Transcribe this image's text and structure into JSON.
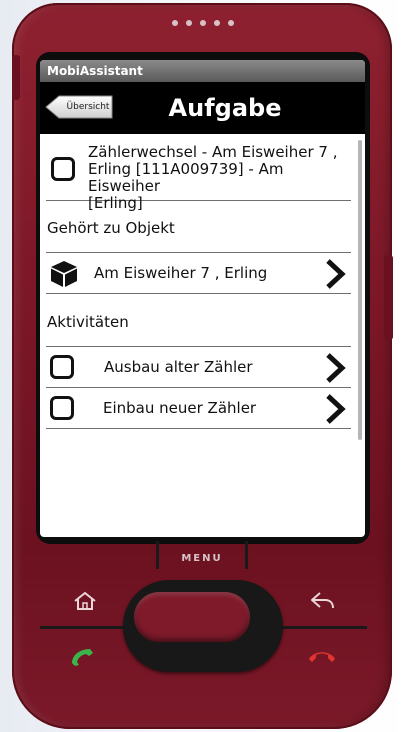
{
  "statusbar": {
    "app_name": "MobiAssistant"
  },
  "titlebar": {
    "back_label": "Übersicht",
    "title": "Aufgabe"
  },
  "task": {
    "text_line1": "Zählerwechsel - Am Eisweiher 7 ,",
    "text_line2": "Erling [111A009739] - Am Eisweiher",
    "text_line3": "[Erling]",
    "checked": false
  },
  "object_section": {
    "label": "Gehört zu Objekt",
    "item": "Am Eisweiher 7 , Erling"
  },
  "activities_section": {
    "label": "Aktivitäten",
    "items": [
      {
        "label": "Ausbau alter Zähler",
        "checked": false
      },
      {
        "label": "Einbau neuer Zähler",
        "checked": false
      }
    ]
  },
  "hardware": {
    "menu_label": "MENU"
  },
  "colors": {
    "device_body": "#7a1626",
    "titlebar_bg": "#000000",
    "screen_bg": "#ffffff"
  }
}
